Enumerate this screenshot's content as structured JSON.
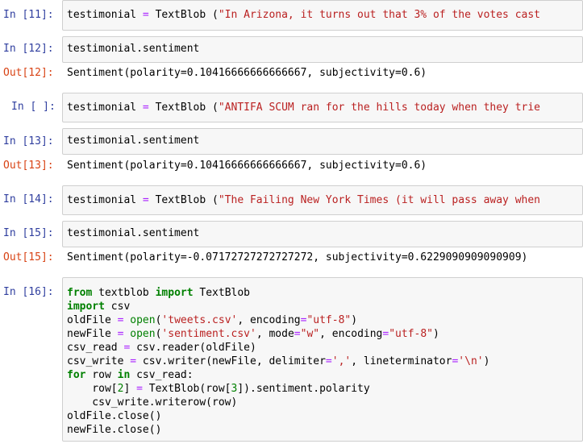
{
  "cells": [
    {
      "prompt": "In [11]:",
      "kind": "in",
      "line": {
        "pre": "testimonial ",
        "op": "=",
        "mid": " TextBlob (",
        "str": "\"In Arizona, it turns out that 3% of the votes cast"
      }
    },
    {
      "prompt": "In [12]:",
      "kind": "in",
      "line": {
        "pre": "testimonial.sentiment"
      }
    },
    {
      "prompt": "Out[12]:",
      "kind": "out",
      "text": "Sentiment(polarity=0.10416666666666667, subjectivity=0.6)"
    },
    {
      "prompt": "In [ ]:",
      "kind": "in",
      "line": {
        "pre": "testimonial ",
        "op": "=",
        "mid": " TextBlob (",
        "str": "\"ANTIFA SCUM ran for the hills today when they trie"
      }
    },
    {
      "prompt": "In [13]:",
      "kind": "in",
      "line": {
        "pre": "testimonial.sentiment"
      }
    },
    {
      "prompt": "Out[13]:",
      "kind": "out",
      "text": "Sentiment(polarity=0.10416666666666667, subjectivity=0.6)"
    },
    {
      "prompt": "In [14]:",
      "kind": "in",
      "line": {
        "pre": "testimonial ",
        "op": "=",
        "mid": " TextBlob (",
        "str": "\"The Failing New York Times (it will pass away when"
      }
    },
    {
      "prompt": "In [15]:",
      "kind": "in",
      "line": {
        "pre": "testimonial.sentiment"
      }
    },
    {
      "prompt": "Out[15]:",
      "kind": "out",
      "text": "Sentiment(polarity=-0.07172727272727272, subjectivity=0.6229090909090909)"
    },
    {
      "prompt": "In [16]:",
      "kind": "in"
    }
  ],
  "code16": {
    "l1": {
      "kw1": "from",
      "a": " textblob ",
      "kw2": "import",
      "b": " TextBlob"
    },
    "l2": {
      "kw": "import",
      "a": " csv"
    },
    "l3": {
      "a": "oldFile ",
      "op": "=",
      "sp": " ",
      "bi": "open",
      "b": "(",
      "s1": "'tweets.csv'",
      "c": ", encoding",
      "op2": "=",
      "s2": "\"utf-8\"",
      "d": ")"
    },
    "l4": {
      "a": "newFile ",
      "op": "=",
      "sp": " ",
      "bi": "open",
      "b": "(",
      "s1": "'sentiment.csv'",
      "c": ", mode",
      "op2": "=",
      "s2": "\"w\"",
      "e": ", encoding",
      "op3": "=",
      "s3": "\"utf-8\"",
      "d": ")"
    },
    "l5": {
      "a": "csv_read ",
      "op": "=",
      "b": " csv.reader(oldFile)"
    },
    "l6": {
      "a": "csv_write ",
      "op": "=",
      "b": " csv.writer(newFile, delimiter",
      "op2": "=",
      "s1": "','",
      "c": ", lineterminator",
      "op3": "=",
      "s2": "'\\n'",
      "d": ")"
    },
    "l7": {
      "kw": "for",
      "a": " row ",
      "kw2": "in",
      "b": " csv_read:"
    },
    "l8": {
      "a": "    row[",
      "n1": "2",
      "b": "] ",
      "op": "=",
      "c": " TextBlob(row[",
      "n2": "3",
      "d": "]).sentiment.polarity"
    },
    "l9": {
      "a": "    csv_write.writerow(row)"
    },
    "l10": {
      "a": "oldFile.close()"
    },
    "l11": {
      "a": "newFile.close()"
    }
  }
}
